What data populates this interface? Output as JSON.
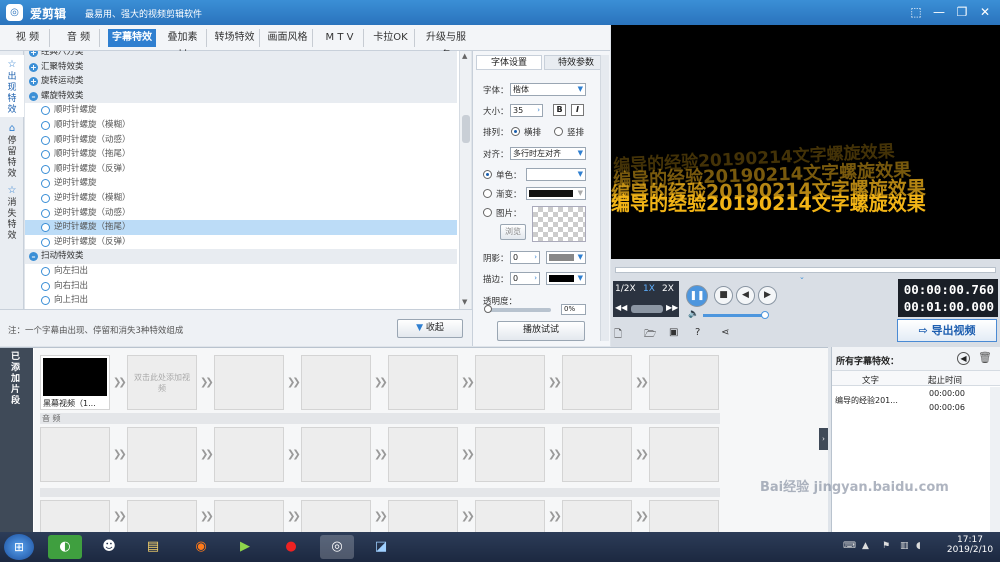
{
  "app": {
    "title": "爱剪辑",
    "slogan": "最易用、强大的视频剪辑软件"
  },
  "tabs": [
    "视 频",
    "音 频",
    "字幕特效",
    "叠加素材",
    "转场特效",
    "画面风格",
    "M T V",
    "卡拉OK",
    "升级与服务"
  ],
  "left_tabs": [
    "出现特效",
    "停留特效",
    "消失特效"
  ],
  "effects": [
    {
      "type": "cat",
      "label": "经典八方类"
    },
    {
      "type": "cat",
      "label": "汇聚特效类"
    },
    {
      "type": "cat",
      "label": "旋转运动类"
    },
    {
      "type": "cat",
      "label": "螺旋特效类"
    },
    {
      "type": "item",
      "label": "顺时针螺旋"
    },
    {
      "type": "item",
      "label": "顺时针螺旋（模糊）"
    },
    {
      "type": "item",
      "label": "顺时针螺旋（动感）"
    },
    {
      "type": "item",
      "label": "顺时针螺旋（拖尾）"
    },
    {
      "type": "item",
      "label": "顺时针螺旋（反弹）"
    },
    {
      "type": "item",
      "label": "逆时针螺旋"
    },
    {
      "type": "item",
      "label": "逆时针螺旋（模糊）"
    },
    {
      "type": "item",
      "label": "逆时针螺旋（动感）"
    },
    {
      "type": "item",
      "label": "逆时针螺旋（拖尾）",
      "selected": true
    },
    {
      "type": "item",
      "label": "逆时针螺旋（反弹）"
    },
    {
      "type": "cat",
      "label": "扫动特效类"
    },
    {
      "type": "item",
      "label": "向左扫出"
    },
    {
      "type": "item",
      "label": "向右扫出"
    },
    {
      "type": "item",
      "label": "向上扫出"
    }
  ],
  "note": "注：一个字幕由出现、停留和消失3种特效组成",
  "collapse_label": "收起",
  "play_label": "播放试试",
  "props": {
    "tab_font": "字体设置",
    "tab_effect": "特效参数",
    "font_label": "字体：",
    "font_value": "楷体",
    "size_label": "大小：",
    "size_value": "35",
    "bold": "B",
    "italic": "I",
    "layout_label": "排列：",
    "horizontal": "横排",
    "vertical": "竖排",
    "align_label": "对齐：",
    "align_value": "多行时左对齐",
    "solid_label": "单色：",
    "gradient_label": "渐变：",
    "image_label": "图片：",
    "browse": "浏览",
    "shadow_label": "阴影：",
    "shadow_value": "0",
    "stroke_label": "描边：",
    "stroke_value": "0",
    "opacity_label": "透明度：",
    "opacity_value": "0%"
  },
  "preview": {
    "caption": "编导的经验20190214文字螺旋效果"
  },
  "controls": {
    "speed_half": "1/2X",
    "speed_1x": "1X",
    "speed_2x": "2X",
    "time_current": "00:00:00.760",
    "time_total": "00:01:00.000",
    "export": "导出视频"
  },
  "timeline": {
    "side_label": "已添加片段",
    "first_clip_label": "黑幕视频（1...",
    "add_hint": "双击此处添加视频",
    "audio_label": "音 频"
  },
  "caption_list": {
    "title": "所有字幕特效：",
    "col_text": "文字",
    "col_time": "起止时间",
    "row_text": "编导的经验201...",
    "row_start": "00:00:00",
    "row_end": "00:00:06"
  },
  "taskbar": {
    "time": "17:17",
    "date": "2019/2/10"
  },
  "watermark": "Bai经验 jingyan.baidu.com"
}
